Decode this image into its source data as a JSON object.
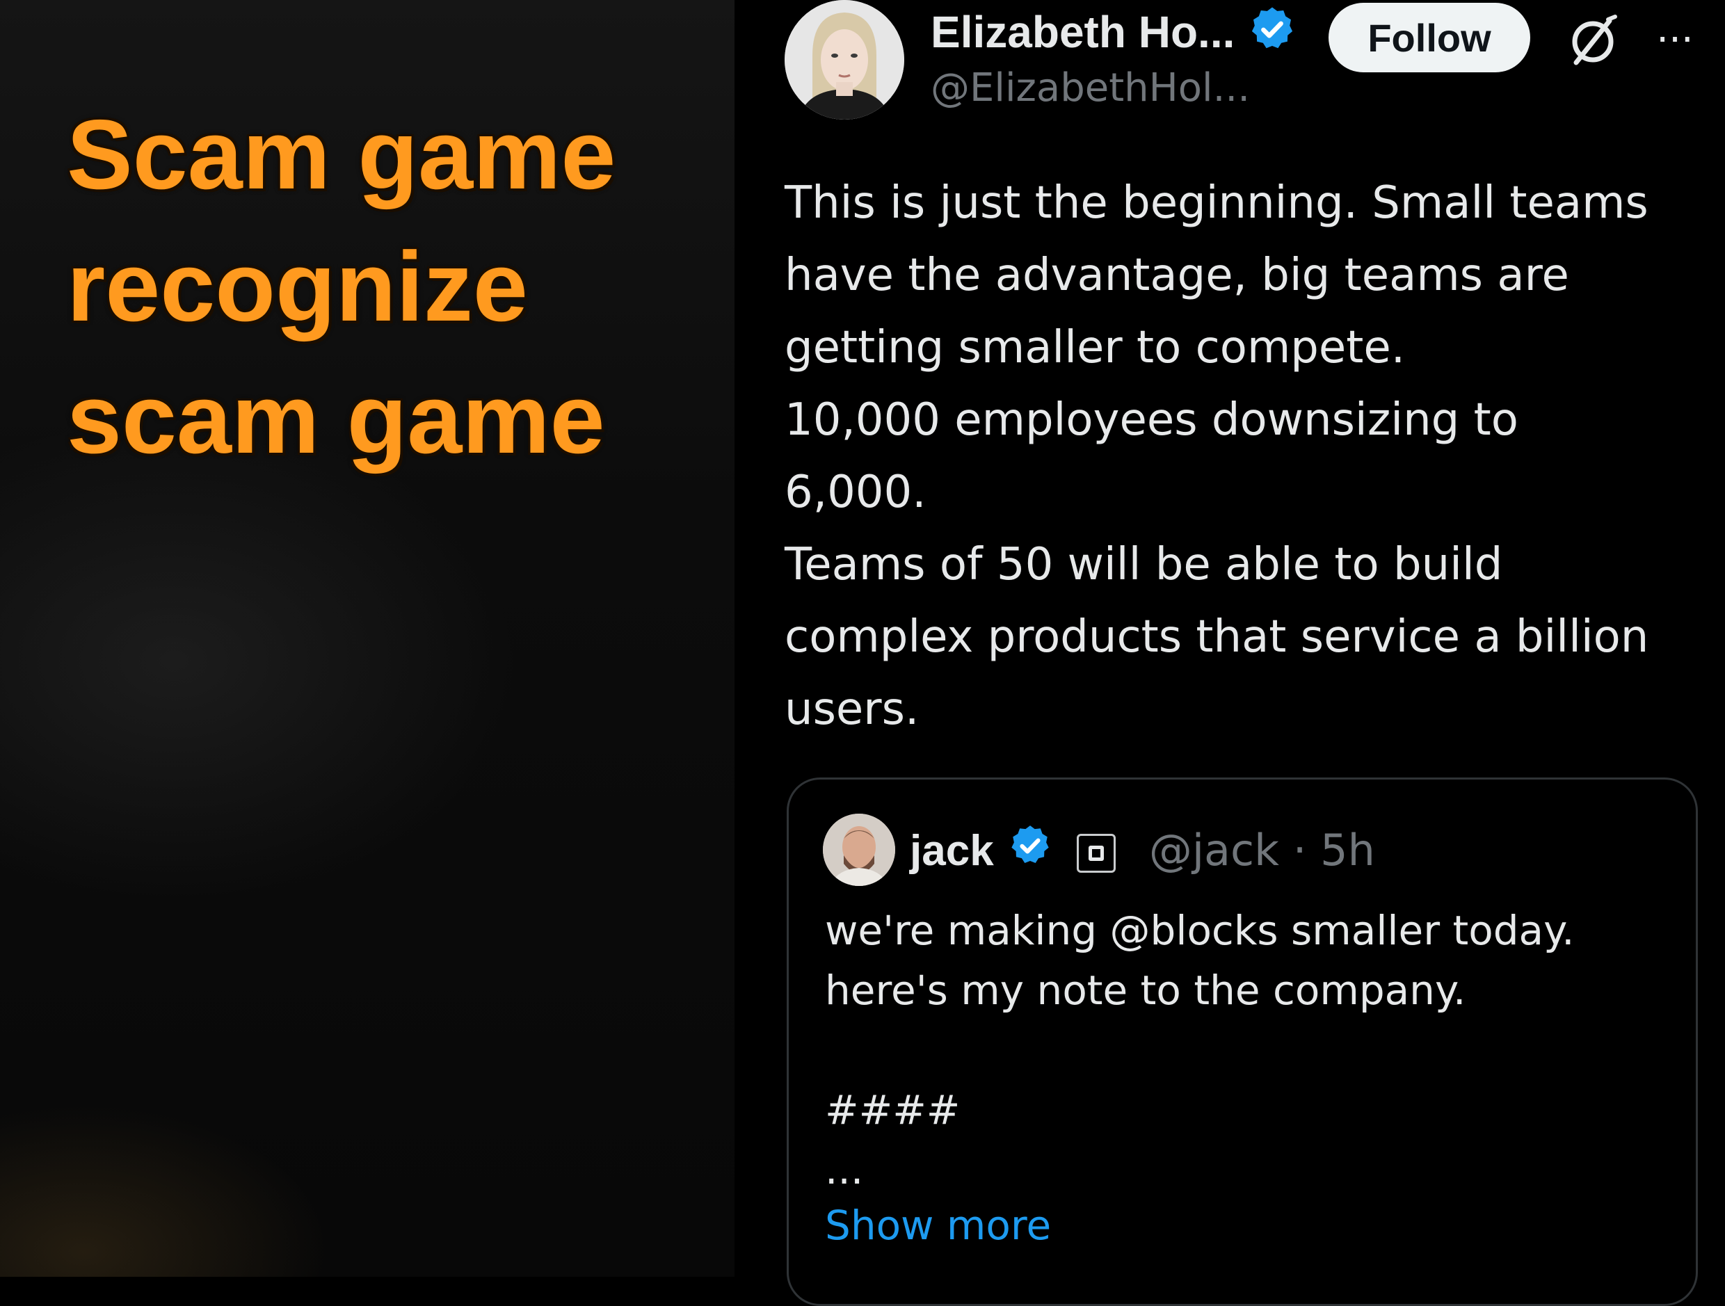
{
  "caption": {
    "lines": [
      "Scam game",
      "recognize",
      "scam game"
    ],
    "color": "#ff9a1f"
  },
  "post": {
    "author_name": "Elizabeth Ho...",
    "author_handle": "@ElizabethHol...",
    "follow_label": "Follow",
    "more_label": "···",
    "body_lines": [
      "This is just the beginning. Small teams",
      "have the advantage, big teams are",
      "getting smaller to compete.",
      "10,000 employees downsizing to",
      "6,000.",
      "Teams of 50 will be able to build",
      "complex products that service a billion",
      "users."
    ],
    "icons": {
      "verified": "verified-badge-icon",
      "grok": "grok-icon",
      "more": "more-options-icon"
    }
  },
  "quote": {
    "author_name": "jack",
    "author_handle": "@jack",
    "time": "· 5h",
    "text_lines": [
      "we're making @blocks smaller today.",
      "here's my note to the company.",
      "",
      "####",
      "..."
    ],
    "show_more_label": "Show more"
  },
  "colors": {
    "accent_orange": "#ff9a1f",
    "verified_blue": "#1d9bf0",
    "text_primary": "#e7e9ea",
    "text_secondary": "#71767b",
    "card_border": "#2f3336"
  }
}
